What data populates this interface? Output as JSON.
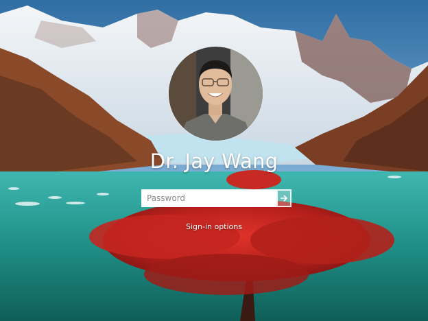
{
  "lock_screen": {
    "user_name": "Dr. Jay Wang",
    "password_placeholder": "Password",
    "password_value": "",
    "sign_in_options_label": "Sign-in options"
  },
  "icons": {
    "submit": "arrow-right-icon",
    "avatar": "user-avatar"
  },
  "colors": {
    "text": "#ffffff",
    "input_bg": "#ffffff",
    "placeholder": "#8a8a8a"
  }
}
